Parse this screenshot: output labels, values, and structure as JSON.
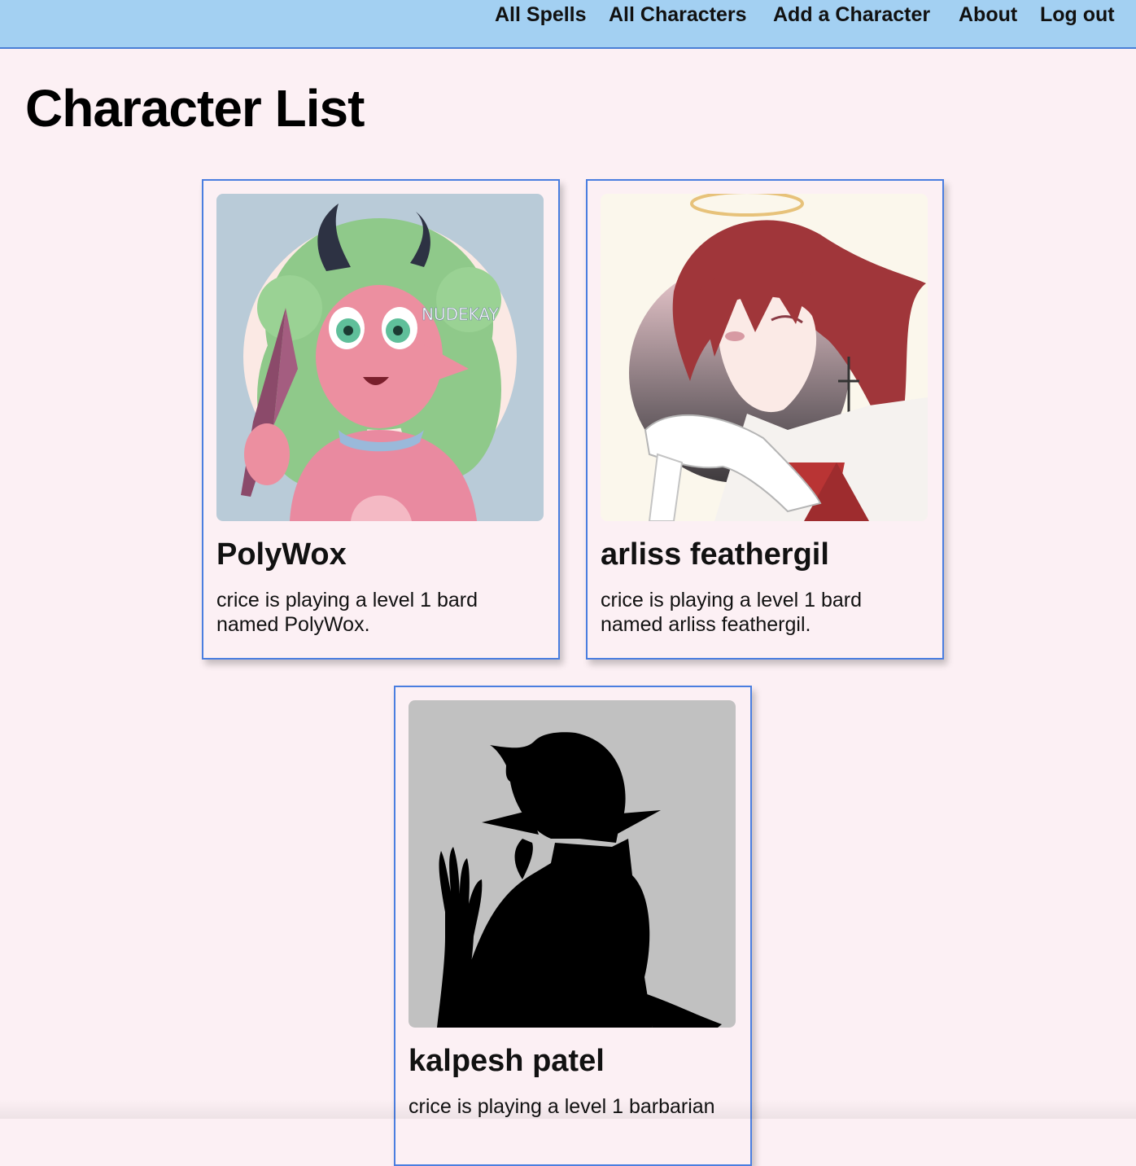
{
  "nav": {
    "links": [
      "All Spells",
      "All Characters",
      "Add a Character",
      "About",
      "Log out"
    ]
  },
  "page": {
    "title": "Character List"
  },
  "characters": [
    {
      "name": "PolyWox",
      "description": "crice is playing a level 1 bard named PolyWox.",
      "image_watermark": "NUDEKAY"
    },
    {
      "name": "arliss feathergil",
      "description": "crice is playing a level 1 bard named arliss feathergil."
    },
    {
      "name": "kalpesh patel",
      "description": "crice is playing a level 1 barbarian"
    }
  ],
  "colors": {
    "navbar_bg": "#a3d0f2",
    "page_bg": "#fcf0f4",
    "card_border": "#4a7ee0"
  }
}
